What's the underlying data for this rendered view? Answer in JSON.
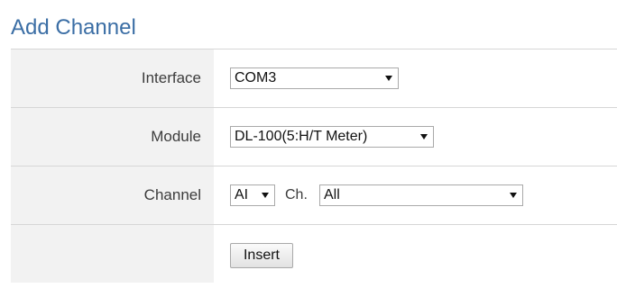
{
  "panel": {
    "title": "Add Channel"
  },
  "form": {
    "interface": {
      "label": "Interface",
      "value": "COM3"
    },
    "module": {
      "label": "Module",
      "value": "DL-100(5:H/T Meter)"
    },
    "channel": {
      "label": "Channel",
      "type_value": "AI",
      "ch_label": "Ch.",
      "ch_value": "All"
    },
    "insert_button_label": "Insert"
  },
  "icons": {
    "dropdown": "dropdown-arrow-icon"
  },
  "colors": {
    "title": "#3b6ea5",
    "label_cell_bg": "#f2f2f2",
    "divider": "#d6d6d6",
    "text": "#3c3c3c"
  }
}
